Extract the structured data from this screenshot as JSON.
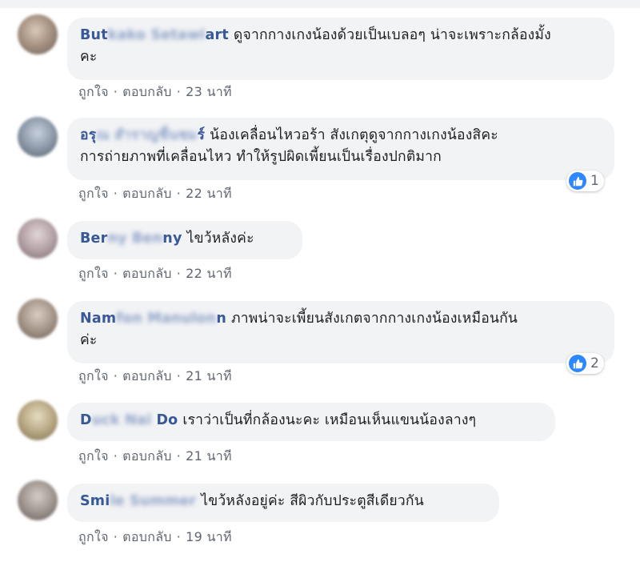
{
  "meta_labels": {
    "like": "ถูกใจ",
    "reply": "ตอบกลับ",
    "separator": "·"
  },
  "comments": [
    {
      "author_prefix": "But",
      "author_blur": "kako Setawi",
      "author_suffix": "art",
      "lines": [
        "ดูจากกางเกงน้องด้วยเป็นเบลอๆ น่าจะเพราะกล้องมั้ง",
        "คะ"
      ],
      "time": "23 นาที"
    },
    {
      "author_prefix": "อร",
      "author_blur": "ุณ สำราญชื่นชม",
      "author_suffix": "ร์",
      "lines": [
        "น้องเคลื่อนไหวอร้า สังเกตุดูจากกางเกงน้องสิคะ",
        "การถ่ายภาพที่เคลื่อนไหว ทำให้รูปผิดเพี้ยนเป็นเรื่องปกติมาก"
      ],
      "time": "22 นาที",
      "reactions": "1"
    },
    {
      "author_prefix": "Ber",
      "author_blur": "ny Ben",
      "author_suffix": "ny",
      "lines": [
        "ไขว้หลังค่ะ"
      ],
      "time": "22 นาที"
    },
    {
      "author_prefix": "Nam",
      "author_blur": "fon Manulon",
      "author_suffix": "n",
      "lines": [
        "ภาพน่าจะเพี้ยนสังเกตจากกางเกงน้องเหมือนกัน",
        "ค่ะ"
      ],
      "time": "21 นาที",
      "reactions": "2"
    },
    {
      "author_prefix": "D",
      "author_blur": "uck Nai",
      "author_suffix": "Do",
      "lines": [
        "เราว่าเป็นที่กล้องนะคะ เหมือนเห็นแขนน้องลางๆ"
      ],
      "time": "21 นาที"
    },
    {
      "author_prefix": "Smi",
      "author_blur": "le Summer",
      "author_suffix": "",
      "lines": [
        "ไขว้หลังอยู่ค่ะ สีผิวกับประตูสีเดียวกัน"
      ],
      "time": "19 นาที"
    }
  ],
  "colors": {
    "author": "#385898",
    "bubble": "#f2f3f5",
    "meta": "#606770",
    "like": "#2d88ff"
  }
}
